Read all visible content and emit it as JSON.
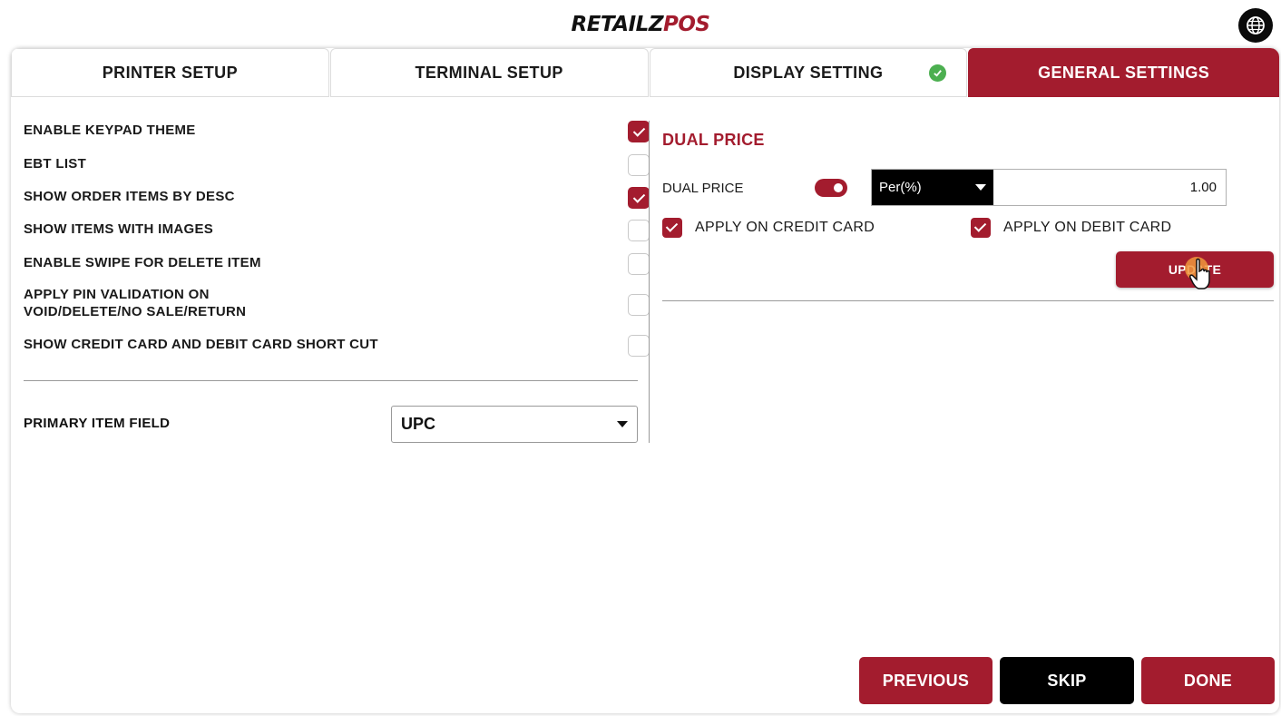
{
  "brand": {
    "part1": "RETAILZ",
    "part2": "POS",
    "accent": "#a31c2e"
  },
  "header": {
    "globe_icon": "globe-icon"
  },
  "tabs": [
    {
      "label": "PRINTER SETUP",
      "active": false
    },
    {
      "label": "TERMINAL SETUP",
      "active": false
    },
    {
      "label": "DISPLAY SETTING",
      "active": false,
      "completed": true
    },
    {
      "label": "GENERAL SETTINGS",
      "active": true
    }
  ],
  "options": [
    {
      "label": "ENABLE KEYPAD THEME",
      "checked": true
    },
    {
      "label": "EBT LIST",
      "checked": false
    },
    {
      "label": "SHOW ORDER ITEMS BY DESC",
      "checked": true
    },
    {
      "label": "SHOW ITEMS WITH IMAGES",
      "checked": false
    },
    {
      "label": "ENABLE SWIPE FOR DELETE ITEM",
      "checked": false
    },
    {
      "label_line1": "APPLY PIN VALIDATION ON",
      "label_line2": "VOID/DELETE/NO SALE/RETURN",
      "checked": false
    },
    {
      "label": "SHOW CREDIT CARD AND DEBIT CARD SHORT CUT",
      "checked": false
    }
  ],
  "primary_item_field": {
    "label": "PRIMARY ITEM FIELD",
    "value": "UPC"
  },
  "dual_price": {
    "title": "DUAL PRICE",
    "label": "DUAL PRICE",
    "enabled": true,
    "type": "Per(%)",
    "value": "1.00",
    "apply_credit": {
      "label": "APPLY ON CREDIT CARD",
      "checked": true
    },
    "apply_debit": {
      "label": "APPLY ON DEBIT CARD",
      "checked": true
    },
    "update_label": "UPDATE"
  },
  "footer": {
    "previous": "PREVIOUS",
    "skip": "SKIP",
    "done": "DONE"
  }
}
